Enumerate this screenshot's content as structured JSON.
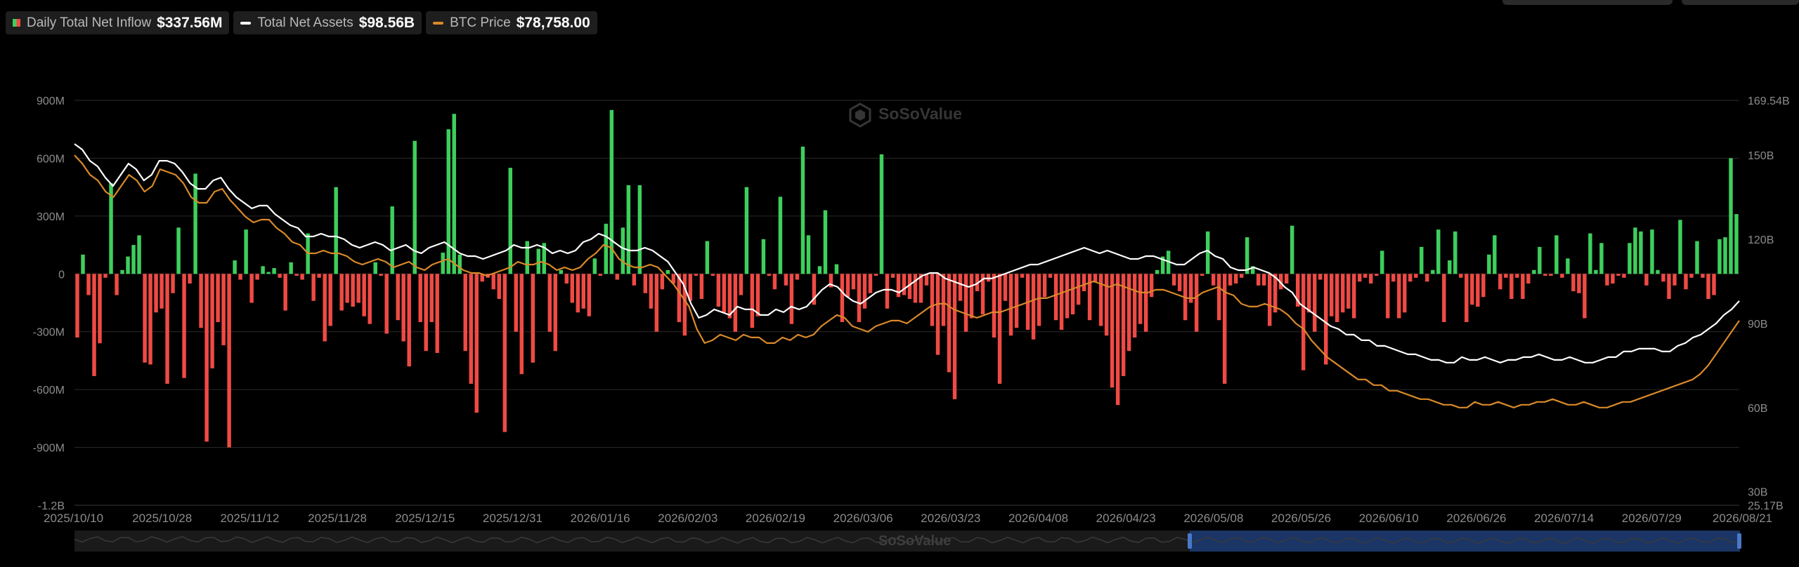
{
  "legend": {
    "inflow": {
      "label": "Daily Total Net Inflow",
      "value": "$337.56M"
    },
    "assets": {
      "label": "Total Net Assets",
      "value": "$98.56B"
    },
    "btc": {
      "label": "BTC Price",
      "value": "$78,758.00"
    }
  },
  "watermark": "SoSoValue",
  "colors": {
    "positive": "#3ecf5c",
    "negative": "#f04a44",
    "assets_line": "#ffffff",
    "btc_line": "#d9892a",
    "grid": "#2b2b2b",
    "axis_text": "#8c8c8c"
  },
  "chart_data": {
    "type": "bar",
    "x_ticks": [
      "2025/10/10",
      "2025/10/28",
      "2025/11/12",
      "2025/11/28",
      "2025/12/15",
      "2025/12/31",
      "2026/01/16",
      "2026/02/03",
      "2026/02/19",
      "2026/03/06",
      "2026/03/23",
      "2026/04/08",
      "2026/04/23",
      "2026/05/08",
      "2026/05/26",
      "2026/06/10",
      "2026/06/26",
      "2026/07/14",
      "2026/07/29",
      "2026/08/21"
    ],
    "y_left_ticks": [
      "900M",
      "600M",
      "300M",
      "0",
      "-300M",
      "-600M",
      "-900M",
      "-1.2B"
    ],
    "y_left_range": [
      -1200,
      900
    ],
    "y_left_unit": "M",
    "y_right_ticks": [
      "169.54B",
      "150B",
      "120B",
      "90B",
      "60B",
      "30B",
      "25.17B"
    ],
    "y_right_range": [
      25.17,
      169.54
    ],
    "y_right_unit": "B",
    "series": [
      {
        "name": "Daily Total Net Inflow",
        "type": "bar",
        "values": [
          -330,
          100,
          -110,
          -530,
          -360,
          -20,
          470,
          -110,
          20,
          90,
          150,
          200,
          -460,
          -470,
          -200,
          -180,
          -570,
          -100,
          240,
          -540,
          -50,
          520,
          -280,
          -870,
          -490,
          -250,
          -370,
          -900,
          70,
          -30,
          230,
          -150,
          -30,
          40,
          10,
          30,
          -20,
          -190,
          60,
          -10,
          -30,
          210,
          -140,
          -20,
          -350,
          -270,
          450,
          -190,
          -150,
          -170,
          -150,
          -220,
          -260,
          60,
          -10,
          -310,
          350,
          -240,
          -350,
          -480,
          690,
          -250,
          -400,
          -250,
          -410,
          110,
          750,
          830,
          100,
          -400,
          -570,
          -720,
          -40,
          -20,
          -80,
          -130,
          -820,
          550,
          -300,
          -520,
          170,
          -460,
          130,
          160,
          -300,
          -400,
          20,
          -50,
          -150,
          -200,
          -180,
          -220,
          80,
          -10,
          260,
          850,
          -30,
          240,
          460,
          -60,
          460,
          -100,
          -180,
          -300,
          -80,
          20,
          -50,
          -250,
          -320,
          -140,
          -10,
          -130,
          170,
          -10,
          -170,
          -200,
          -230,
          -300,
          -110,
          450,
          -280,
          -220,
          180,
          -10,
          -80,
          400,
          -60,
          -260,
          -30,
          660,
          200,
          -160,
          40,
          330,
          -70,
          50,
          -250,
          -120,
          -80,
          -250,
          -180,
          -100,
          -10,
          620,
          -180,
          -20,
          -120,
          -110,
          -130,
          -150,
          -150,
          -60,
          -270,
          -420,
          -270,
          -510,
          -650,
          -140,
          -300,
          -230,
          -90,
          -210,
          -40,
          -330,
          -570,
          -140,
          -320,
          -280,
          -20,
          -290,
          -340,
          -270,
          -120,
          -20,
          -240,
          -290,
          -230,
          -210,
          -160,
          -90,
          -240,
          -40,
          -270,
          -320,
          -590,
          -680,
          -530,
          -400,
          -330,
          -260,
          -300,
          -120,
          20,
          90,
          120,
          -60,
          -90,
          -240,
          -150,
          -300,
          -10,
          220,
          -60,
          -240,
          -570,
          -60,
          -50,
          -20,
          190,
          40,
          -60,
          -60,
          -270,
          -200,
          -80,
          -50,
          250,
          -170,
          -500,
          -200,
          -300,
          -30,
          -470,
          -220,
          -250,
          -200,
          -180,
          -230,
          -40,
          -20,
          -50,
          -10,
          120,
          -230,
          -40,
          -230,
          -200,
          -40,
          -20,
          140,
          -40,
          20,
          230,
          -250,
          70,
          220,
          -20,
          -250,
          -160,
          -170,
          -120,
          100,
          200,
          -80,
          -20,
          -130,
          -20,
          -130,
          -50,
          20,
          140,
          -10,
          -10,
          200,
          -20,
          80,
          -90,
          -100,
          -230,
          210,
          20,
          160,
          -60,
          -50,
          -10,
          -20,
          160,
          240,
          220,
          -60,
          230,
          20,
          -40,
          -130,
          -60,
          280,
          -80,
          -20,
          170,
          -20,
          -130,
          -110,
          180,
          190,
          600,
          310
        ]
      },
      {
        "name": "Total Net Assets",
        "type": "line",
        "axis": "right",
        "values": [
          154,
          152,
          148,
          146,
          142,
          139,
          143,
          147,
          145,
          141,
          143,
          148,
          148,
          147,
          144,
          140,
          138,
          138,
          141,
          142,
          138,
          135,
          133,
          131,
          132,
          132,
          129,
          127,
          125,
          124,
          121,
          121,
          122,
          121,
          121,
          120,
          118,
          117,
          118,
          119,
          118,
          116,
          117,
          118,
          116,
          115,
          117,
          118,
          119,
          117,
          115,
          114,
          114,
          113,
          114,
          115,
          116,
          118,
          117,
          117,
          118,
          117,
          115,
          116,
          115,
          116,
          119,
          120,
          122,
          121,
          119,
          117,
          116,
          116,
          117,
          116,
          114,
          112,
          108,
          104,
          97,
          92,
          93,
          95,
          94,
          93,
          96,
          95,
          95,
          93,
          93,
          95,
          94,
          96,
          95,
          96,
          99,
          102,
          104,
          103,
          100,
          98,
          97,
          99,
          101,
          102,
          102,
          101,
          103,
          105,
          107,
          108,
          108,
          106,
          105,
          104,
          103,
          104,
          106,
          106,
          107,
          108,
          109,
          110,
          111,
          111,
          112,
          113,
          114,
          115,
          116,
          117,
          116,
          115,
          116,
          115,
          114,
          113,
          113,
          114,
          114,
          113,
          112,
          111,
          111,
          113,
          115,
          116,
          114,
          113,
          110,
          109,
          109,
          110,
          109,
          108,
          106,
          103,
          101,
          97,
          95,
          93,
          91,
          89,
          88,
          86,
          86,
          84,
          84,
          82,
          82,
          81,
          80,
          79,
          79,
          78,
          77,
          77,
          76,
          76,
          78,
          77,
          77,
          78,
          77,
          76,
          77,
          77,
          78,
          78,
          79,
          78,
          77,
          77,
          78,
          77,
          76,
          76,
          77,
          78,
          78,
          80,
          80,
          81,
          81,
          81,
          80,
          80,
          82,
          83,
          85,
          86,
          88,
          90,
          93,
          95,
          98
        ]
      },
      {
        "name": "BTC Price",
        "type": "line",
        "axis": "right",
        "values": [
          150,
          147,
          143,
          141,
          137,
          135,
          139,
          143,
          141,
          137,
          139,
          145,
          144,
          143,
          140,
          135,
          133,
          133,
          137,
          138,
          134,
          131,
          128,
          126,
          127,
          127,
          124,
          122,
          119,
          118,
          115,
          115,
          116,
          115,
          115,
          114,
          112,
          111,
          112,
          113,
          112,
          110,
          111,
          112,
          110,
          109,
          111,
          112,
          113,
          111,
          109,
          108,
          108,
          107,
          108,
          109,
          110,
          112,
          111,
          111,
          112,
          111,
          109,
          110,
          109,
          110,
          113,
          115,
          118,
          117,
          113,
          111,
          110,
          110,
          111,
          110,
          107,
          104,
          100,
          96,
          88,
          83,
          84,
          86,
          85,
          84,
          86,
          85,
          85,
          83,
          83,
          85,
          84,
          86,
          85,
          86,
          89,
          91,
          93,
          92,
          89,
          88,
          87,
          89,
          90,
          91,
          91,
          90,
          92,
          94,
          96,
          97,
          97,
          95,
          94,
          93,
          92,
          93,
          94,
          94,
          95,
          96,
          97,
          98,
          99,
          99,
          100,
          101,
          102,
          103,
          104,
          105,
          104,
          103,
          104,
          103,
          102,
          101,
          101,
          102,
          102,
          101,
          100,
          99,
          99,
          101,
          102,
          103,
          101,
          100,
          97,
          96,
          96,
          97,
          96,
          95,
          93,
          90,
          88,
          84,
          81,
          78,
          76,
          74,
          72,
          70,
          70,
          68,
          68,
          66,
          66,
          65,
          64,
          63,
          63,
          62,
          61,
          61,
          60,
          60,
          62,
          61,
          61,
          62,
          61,
          60,
          61,
          61,
          62,
          62,
          63,
          62,
          61,
          61,
          62,
          61,
          60,
          60,
          61,
          62,
          62,
          63,
          64,
          65,
          66,
          67,
          68,
          69,
          70,
          72,
          75,
          79,
          83,
          87,
          91
        ]
      }
    ],
    "navigator": {
      "label": "SoSoValue"
    }
  }
}
